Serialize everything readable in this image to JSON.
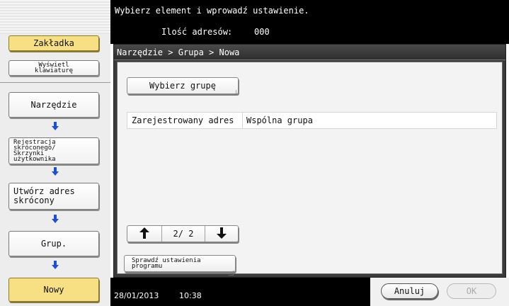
{
  "header": {
    "message": "Wybierz element i wprowadź ustawienie.",
    "address_count_label": "Ilość adresów",
    "address_count_separator": ":",
    "address_count_value": "000"
  },
  "sidebar": {
    "tab_label": "Zakładka",
    "keyboard_label": "Wyświetl\nklawiaturę",
    "steps": [
      {
        "label": "Narzędzie"
      },
      {
        "label": "Rejestracja\nskróconego/\nSkrzynki\nużytkownika"
      },
      {
        "label": "Utwórz adres skrócony"
      },
      {
        "label": "Grup."
      },
      {
        "label": "Nowy"
      }
    ]
  },
  "main": {
    "breadcrumb": "Narzędzie > Grupa > Nowa",
    "select_group_label": "Wybierz grupę",
    "field": {
      "label": "Zarejestrowany adres",
      "value": "Wspólna grupa"
    },
    "pager": {
      "page_text": "2/ 2",
      "up_icon": "arrow-up-icon",
      "down_icon": "arrow-down-icon"
    },
    "check_program_label": "Sprawdź ustawienia\nprogramu"
  },
  "footer": {
    "date": "28/01/2013",
    "time": "10:38",
    "cancel_label": "Anuluj",
    "ok_label": "OK"
  },
  "colors": {
    "highlight_yellow": "#f7e084",
    "arrow_blue": "#1a4fd6",
    "bar_black": "#000000",
    "panel_dark": "#3a3a3a"
  }
}
